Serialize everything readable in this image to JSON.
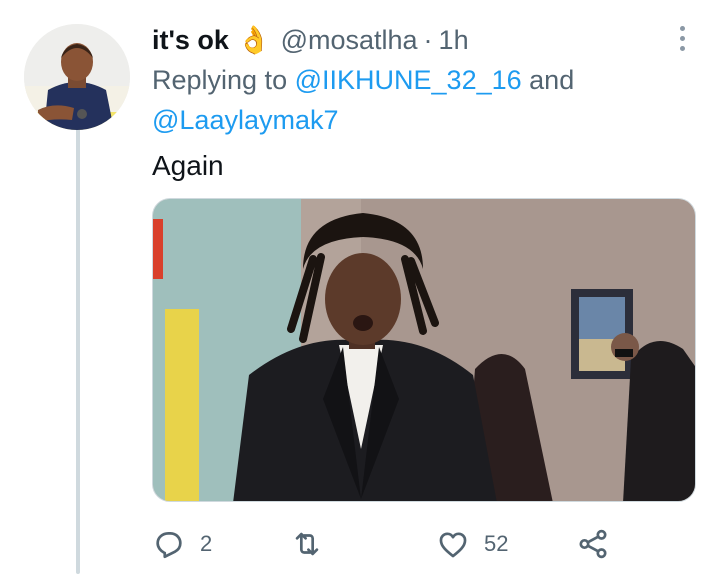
{
  "tweet": {
    "display_name": "it's ok",
    "name_emoji": "👌",
    "handle": "@mosatlha",
    "separator": "·",
    "time": "1h",
    "replying_prefix": "Replying to",
    "reply_to": [
      "@IIKHUNE_32_16",
      "@Laaylaymak7"
    ],
    "reply_joiner": "and",
    "text": "Again"
  },
  "actions": {
    "reply_count": "2",
    "retweet_count": "",
    "like_count": "52"
  },
  "icons": {
    "more": "more-options-icon",
    "reply": "reply-icon",
    "retweet": "retweet-icon",
    "like": "heart-icon",
    "share": "share-icon"
  },
  "colors": {
    "link": "#1d9bf0",
    "secondary_text": "#536471",
    "thread_line": "#cfd9de"
  }
}
